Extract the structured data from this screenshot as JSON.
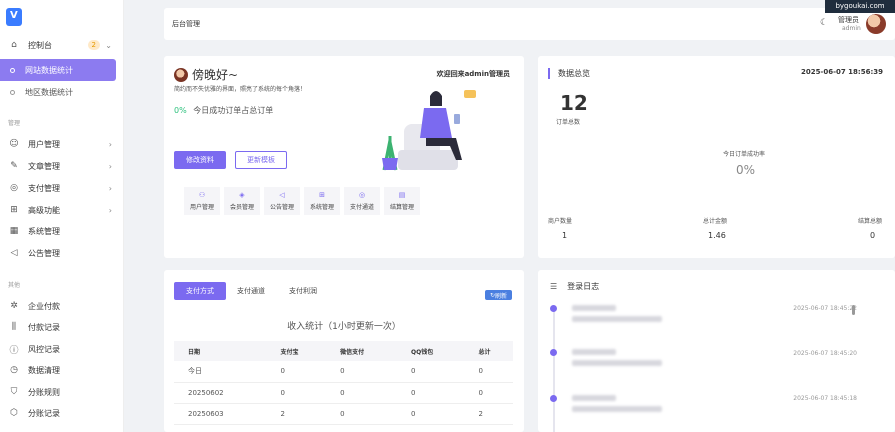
{
  "sidebar": {
    "dashboard": {
      "label": "控制台",
      "badge": "2"
    },
    "sub": [
      {
        "label": "网站数据统计",
        "active": true
      },
      {
        "label": "地区数据统计",
        "active": false
      }
    ],
    "section_manage": "管理",
    "manage_items": [
      {
        "label": "用户管理",
        "icon": "users-icon",
        "chevron": true
      },
      {
        "label": "文章管理",
        "icon": "edit-icon",
        "chevron": true
      },
      {
        "label": "支付管理",
        "icon": "check-circle-icon",
        "chevron": true
      },
      {
        "label": "高级功能",
        "icon": "grid-icon",
        "chevron": true
      },
      {
        "label": "系统管理",
        "icon": "apps-icon",
        "chevron": false
      },
      {
        "label": "公告管理",
        "icon": "speaker-icon",
        "chevron": false
      }
    ],
    "section_other": "其他",
    "other_items": [
      {
        "label": "企业付款",
        "icon": "settings-icon"
      },
      {
        "label": "付款记录",
        "icon": "sliders-icon"
      },
      {
        "label": "风控记录",
        "icon": "alert-icon"
      },
      {
        "label": "数据清理",
        "icon": "clock-icon"
      },
      {
        "label": "分账规则",
        "icon": "shield-icon"
      },
      {
        "label": "分账记录",
        "icon": "cube-icon"
      }
    ]
  },
  "header": {
    "title": "后台管理",
    "role": "管理员",
    "username": "admin",
    "watermark": "bygoukai.com"
  },
  "welcome": {
    "greeting": "傍晚好~",
    "subtitle": "简约而不失优雅的界面，照亮了系统的每个角落！",
    "right_text": "欢迎回来admin管理员",
    "percent": "0%",
    "percent_text": "今日成功订单占总订单",
    "btn_edit": "修改资料",
    "btn_template": "更新模板",
    "quick": [
      {
        "label": "用户管理",
        "icon": "user-icon"
      },
      {
        "label": "会员管理",
        "icon": "diamond-icon"
      },
      {
        "label": "公告管理",
        "icon": "speaker-icon"
      },
      {
        "label": "系统管理",
        "icon": "grid-icon"
      },
      {
        "label": "支付通道",
        "icon": "check-icon"
      },
      {
        "label": "结算管理",
        "icon": "doc-icon"
      }
    ]
  },
  "stats": {
    "title": "数据总览",
    "datetime": "2025-06-07 18:56:39",
    "orders_total": "12",
    "orders_total_label": "订单总数",
    "rate_label": "今日订单成功率",
    "rate_value": "0%",
    "items": [
      {
        "label": "商户数量",
        "value": "1"
      },
      {
        "label": "总计金额",
        "value": "1.46"
      },
      {
        "label": "结算总额",
        "value": "0"
      }
    ]
  },
  "payments": {
    "tabs": [
      "支付方式",
      "支付通道",
      "支付利润"
    ],
    "refresh_label": "刷新",
    "subtitle": "收入统计（1小时更新一次）",
    "columns": [
      "日期",
      "支付宝",
      "微信支付",
      "QQ钱包",
      "总计"
    ],
    "rows": [
      [
        "今日",
        "0",
        "0",
        "0",
        "0"
      ],
      [
        "20250602",
        "0",
        "0",
        "0",
        "0"
      ],
      [
        "20250603",
        "2",
        "0",
        "0",
        "2"
      ],
      [
        "20250604",
        "0",
        "0",
        "0",
        "0"
      ]
    ]
  },
  "logs": {
    "title": "登录日志",
    "entries": [
      {
        "time": "2025-06-07 18:45:22"
      },
      {
        "time": "2025-06-07 18:45:20"
      },
      {
        "time": "2025-06-07 18:45:18"
      }
    ]
  }
}
